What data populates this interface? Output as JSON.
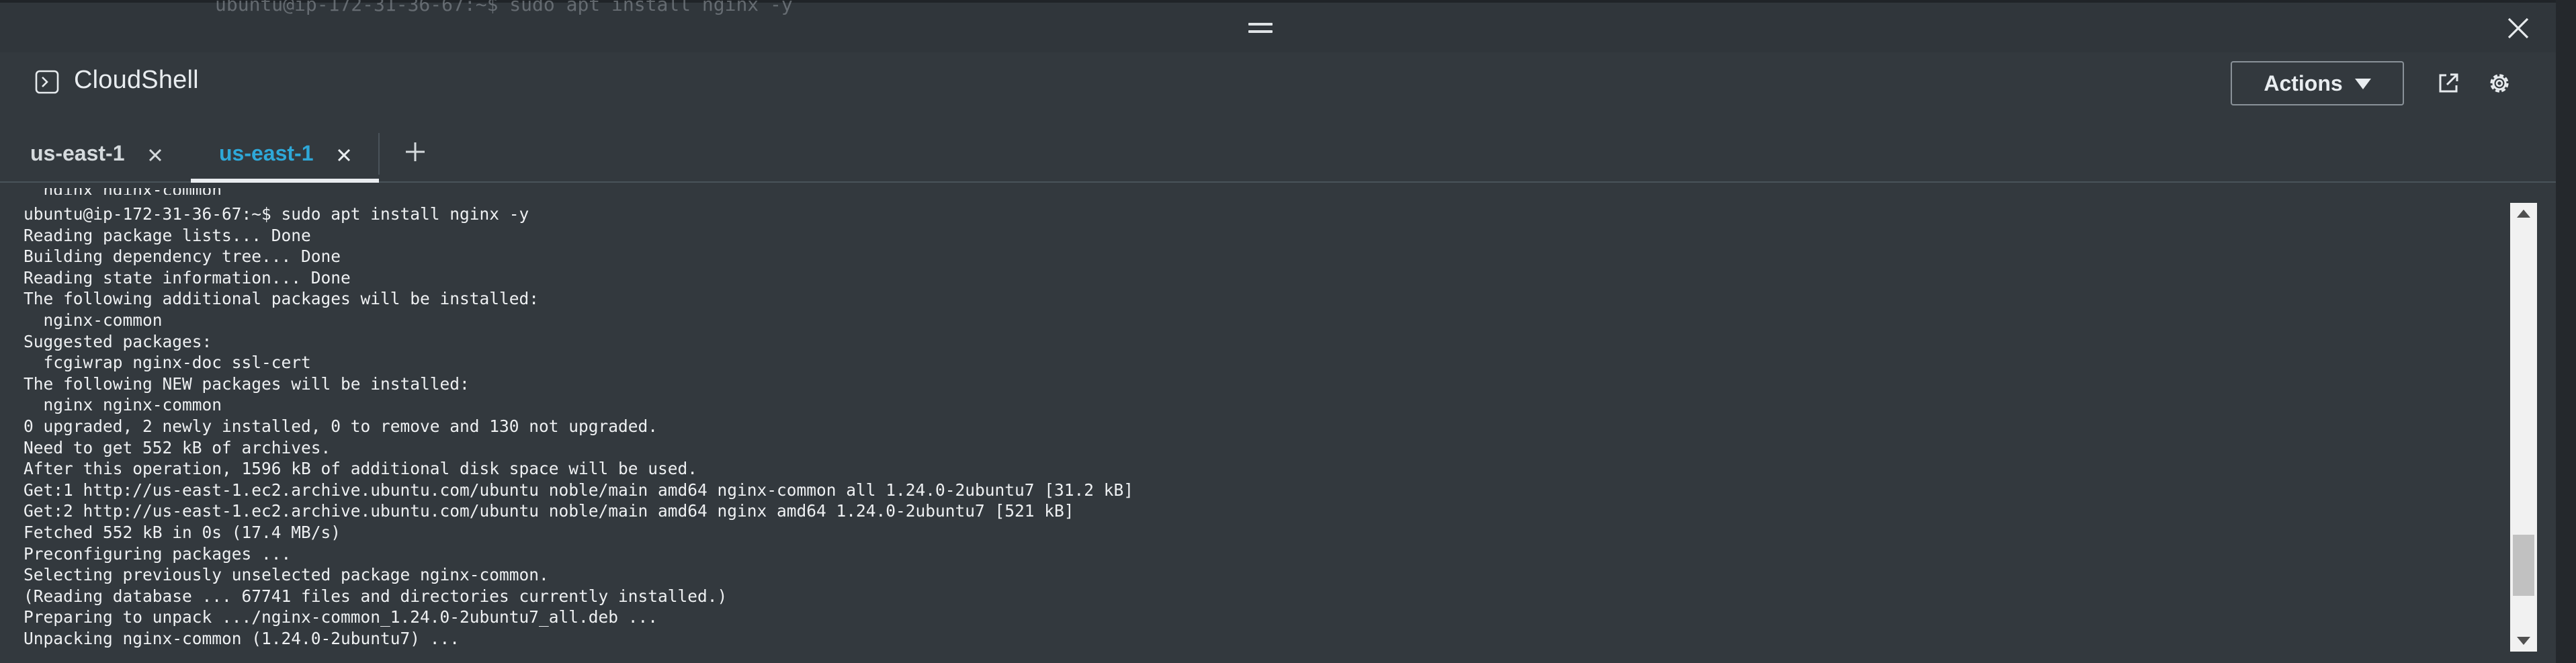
{
  "window": {
    "partial_text_above": "ubuntu@ip-172-31-36-67:~$ sudo apt install nginx -y"
  },
  "header": {
    "title": "CloudShell",
    "title_icon": "terminal-icon",
    "actions_label": "Actions",
    "open_new_window_icon": "external-link-icon",
    "settings_icon": "gear-icon"
  },
  "tabs": [
    {
      "label": "us-east-1",
      "active": false
    },
    {
      "label": "us-east-1",
      "active": true
    }
  ],
  "colors": {
    "active_tab": "#2ea8d8",
    "background": "#33393e",
    "terminal_text": "#eef0f2"
  },
  "terminal": {
    "lines": [
      "ubuntu@ip-172-31-36-67:~$ sudo apt install nginx -y",
      "Reading package lists... Done",
      "Building dependency tree... Done",
      "Reading state information... Done",
      "The following additional packages will be installed:",
      "  nginx-common",
      "Suggested packages:",
      "  fcgiwrap nginx-doc ssl-cert",
      "The following NEW packages will be installed:",
      "  nginx nginx-common",
      "0 upgraded, 2 newly installed, 0 to remove and 130 not upgraded.",
      "Need to get 552 kB of archives.",
      "After this operation, 1596 kB of additional disk space will be used.",
      "Get:1 http://us-east-1.ec2.archive.ubuntu.com/ubuntu noble/main amd64 nginx-common all 1.24.0-2ubuntu7 [31.2 kB]",
      "Get:2 http://us-east-1.ec2.archive.ubuntu.com/ubuntu noble/main amd64 nginx amd64 1.24.0-2ubuntu7 [521 kB]",
      "Fetched 552 kB in 0s (17.4 MB/s)",
      "Preconfiguring packages ...",
      "Selecting previously unselected package nginx-common.",
      "(Reading database ... 67741 files and directories currently installed.)",
      "Preparing to unpack .../nginx-common_1.24.0-2ubuntu7_all.deb ...",
      "Unpacking nginx-common (1.24.0-2ubuntu7) ..."
    ],
    "scroll_position": 0.9,
    "scroll_visible_fraction": 0.15
  }
}
